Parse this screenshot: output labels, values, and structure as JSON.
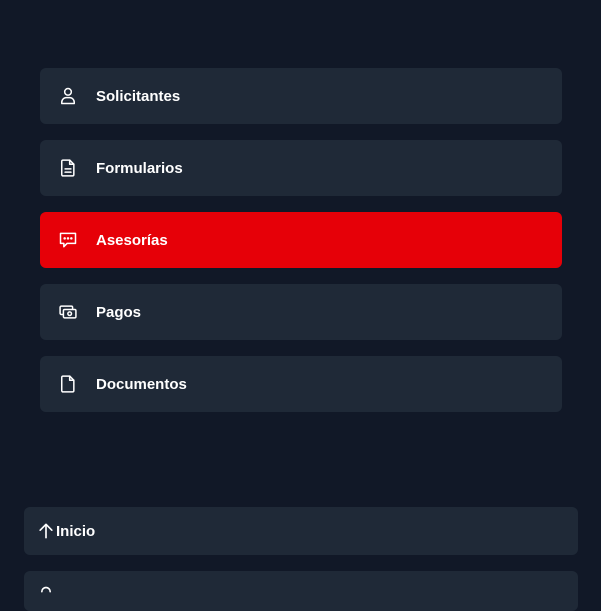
{
  "nav": {
    "items": [
      {
        "label": "Solicitantes",
        "icon": "user-icon",
        "active": false
      },
      {
        "label": "Formularios",
        "icon": "document-text-icon",
        "active": false
      },
      {
        "label": "Asesorías",
        "icon": "chat-bubble-icon",
        "active": true
      },
      {
        "label": "Pagos",
        "icon": "cash-icon",
        "active": false
      },
      {
        "label": "Documentos",
        "icon": "document-icon",
        "active": false
      }
    ]
  },
  "bottom": {
    "inicio_label": "Inicio",
    "inicio_icon": "arrow-up-icon"
  },
  "colors": {
    "background": "#111827",
    "card": "#1f2937",
    "active": "#e60008",
    "text": "#ffffff"
  }
}
